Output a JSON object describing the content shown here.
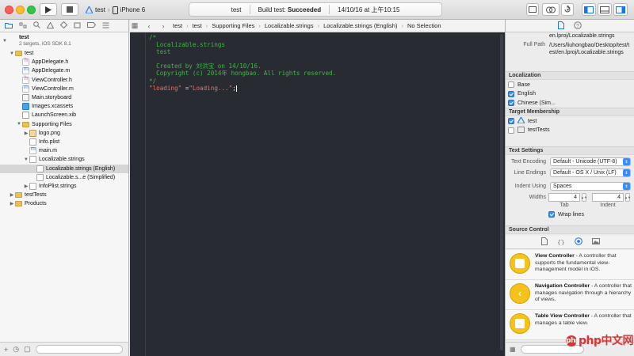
{
  "toolbar": {
    "run_icon": "play-icon",
    "stop_icon": "stop-icon",
    "scheme": {
      "target": "test",
      "separator": "›",
      "device": "iPhone 6"
    },
    "activity": {
      "project": "test",
      "status_prefix": "Build test:",
      "status": "Succeeded",
      "timestamp": "14/10/16 at 上午10:15"
    }
  },
  "navigator": {
    "tabs": [
      "folder-icon",
      "symbol-icon",
      "search-icon",
      "warning-icon",
      "test-icon",
      "debug-icon",
      "breakpoint-icon",
      "report-icon"
    ],
    "items": [
      {
        "label": "test",
        "sub": "2 targets, iOS SDK 8.1",
        "icon": "project",
        "indent": 0,
        "disclosure": "▼"
      },
      {
        "label": "test",
        "icon": "folder",
        "indent": 1,
        "disclosure": "▼"
      },
      {
        "label": "AppDelegate.h",
        "icon": "h",
        "indent": 2
      },
      {
        "label": "AppDelegate.m",
        "icon": "m",
        "indent": 2
      },
      {
        "label": "ViewController.h",
        "icon": "h",
        "indent": 2
      },
      {
        "label": "ViewController.m",
        "icon": "m",
        "indent": 2
      },
      {
        "label": "Main.storyboard",
        "icon": "sb",
        "indent": 2
      },
      {
        "label": "Images.xcassets",
        "icon": "assets",
        "indent": 2
      },
      {
        "label": "LaunchScreen.xib",
        "icon": "xib",
        "indent": 2
      },
      {
        "label": "Supporting Files",
        "icon": "folder",
        "indent": 2,
        "disclosure": "▼"
      },
      {
        "label": "logo.png",
        "icon": "png",
        "indent": 3,
        "disclosure": "▶"
      },
      {
        "label": "Info.plist",
        "icon": "plist",
        "indent": 3
      },
      {
        "label": "main.m",
        "icon": "m",
        "indent": 3
      },
      {
        "label": "Localizable.strings",
        "icon": "strings",
        "indent": 3,
        "disclosure": "▼"
      },
      {
        "label": "Localizable.strings (English)",
        "icon": "strings",
        "indent": 4,
        "selected": true
      },
      {
        "label": "Localizable.s...e (Simplified)",
        "icon": "strings",
        "indent": 4
      },
      {
        "label": "InfoPlist.strings",
        "icon": "strings",
        "indent": 3,
        "disclosure": "▶"
      },
      {
        "label": "testTests",
        "icon": "folder",
        "indent": 1,
        "disclosure": "▶"
      },
      {
        "label": "Products",
        "icon": "folder",
        "indent": 1,
        "disclosure": "▶"
      }
    ]
  },
  "jumpbar": {
    "crumbs": [
      "test",
      "test",
      "Supporting Files",
      "Localizable.strings",
      "Localizable.strings (English)",
      "No Selection"
    ]
  },
  "editor": {
    "lines": [
      {
        "kind": "comment",
        "text": "/*"
      },
      {
        "kind": "comment",
        "text": "  Localizable.strings"
      },
      {
        "kind": "comment",
        "text": "  test"
      },
      {
        "kind": "comment",
        "text": ""
      },
      {
        "kind": "comment",
        "text": "  Created by 刘洪宝 on 14/10/16."
      },
      {
        "kind": "comment",
        "text": "  Copyright (c) 2014年 hongbao. All rights reserved."
      },
      {
        "kind": "comment",
        "text": "*/"
      }
    ],
    "last_line": {
      "key": "\"loading\"",
      "eq": " =",
      "value": "\"Loading...\"",
      "end": ";"
    }
  },
  "inspector": {
    "identity": {
      "name_tail": "en.lproj/Localizable.strings",
      "full_path_label": "Full Path",
      "full_path": "/Users/liuhongbao/Desktop/test/test/en.lproj/Localizable.strings"
    },
    "localization": {
      "title": "Localization",
      "items": [
        {
          "label": "Base",
          "checked": false
        },
        {
          "label": "English",
          "checked": true
        },
        {
          "label": "Chinese (Sim...",
          "checked": true
        }
      ]
    },
    "target_membership": {
      "title": "Target Membership",
      "items": [
        {
          "label": "test",
          "checked": true
        },
        {
          "label": "testTests",
          "checked": false
        }
      ]
    },
    "text_settings": {
      "title": "Text Settings",
      "encoding_label": "Text Encoding",
      "encoding": "Default - Unicode (UTF-8)",
      "endings_label": "Line Endings",
      "endings": "Default - OS X / Unix (LF)",
      "indent_label": "Indent Using",
      "indent": "Spaces",
      "widths_label": "Widths",
      "tab_width": "4",
      "indent_width": "4",
      "tab_label": "Tab",
      "indent_sub_label": "Indent",
      "wrap_label": "Wrap lines",
      "wrap_checked": true
    },
    "source_control": {
      "title": "Source Control"
    },
    "library": [
      {
        "title": "View Controller",
        "desc": " - A controller that supports the fundamental view-management model in iOS.",
        "icon": "square"
      },
      {
        "title": "Navigation Controller",
        "desc": " - A controller that manages navigation through a hierarchy of views.",
        "icon": "chevron"
      },
      {
        "title": "Table View Controller",
        "desc": " - A controller that manages a table view.",
        "icon": "square"
      }
    ]
  },
  "watermark": {
    "text": "php中文网",
    "dot": "php"
  }
}
